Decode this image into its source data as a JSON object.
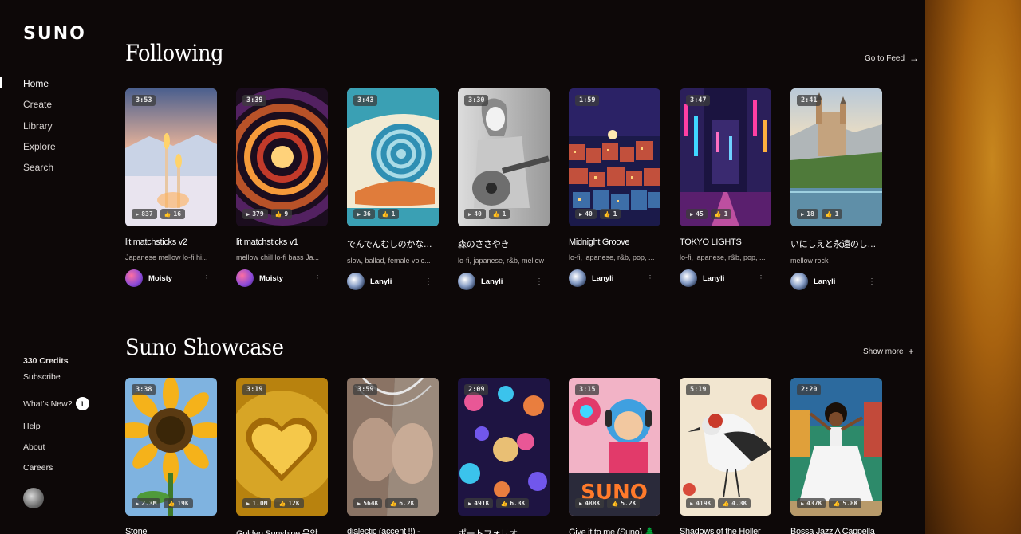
{
  "brand": {
    "logo": "SUNO"
  },
  "nav": [
    {
      "label": "Home",
      "active": true
    },
    {
      "label": "Create"
    },
    {
      "label": "Library"
    },
    {
      "label": "Explore"
    },
    {
      "label": "Search"
    }
  ],
  "account": {
    "credits": "330 Credits",
    "subscribe": "Subscribe",
    "whats_new": "What's New?",
    "whats_new_count": "1",
    "links": [
      "Help",
      "About",
      "Careers"
    ]
  },
  "following": {
    "title": "Following",
    "link": "Go to Feed",
    "cards": [
      {
        "duration": "3:53",
        "plays": "837",
        "likes": "16",
        "title": "lit matchsticks v2",
        "tags": "Japanese mellow lo-fi hi...",
        "user": "Moisty",
        "art": "candles",
        "avatar": "moisty"
      },
      {
        "duration": "3:39",
        "plays": "379",
        "likes": "9",
        "title": "lit matchsticks v1",
        "tags": "mellow chill lo-fi bass Ja...",
        "user": "Moisty",
        "art": "spiral",
        "avatar": "moisty"
      },
      {
        "duration": "3:43",
        "plays": "36",
        "likes": "1",
        "title": "でんでんむしのかなしみ",
        "tags": "slow, ballad, female voic...",
        "user": "Lanyli",
        "art": "snail",
        "avatar": "lanyli"
      },
      {
        "duration": "3:30",
        "plays": "40",
        "likes": "1",
        "title": "森のささやき",
        "tags": "lo-fi, japanese, r&b, mellow",
        "user": "Lanyli",
        "art": "guitar",
        "avatar": "lanyli"
      },
      {
        "duration": "1:59",
        "plays": "40",
        "likes": "1",
        "title": "Midnight Groove",
        "tags": "lo-fi, japanese, r&b, pop, ...",
        "user": "Lanyli",
        "art": "town",
        "avatar": "lanyli"
      },
      {
        "duration": "3:47",
        "plays": "45",
        "likes": "1",
        "title": "TOKYO LIGHTS",
        "tags": "lo-fi, japanese, r&b, pop, ...",
        "user": "Lanyli",
        "art": "neon",
        "avatar": "lanyli"
      },
      {
        "duration": "2:41",
        "plays": "18",
        "likes": "1",
        "title": "いにしえと永遠のしらべ",
        "tags": "mellow rock",
        "user": "Lanyli",
        "art": "castle",
        "avatar": "lanyli"
      }
    ]
  },
  "showcase": {
    "title": "Suno Showcase",
    "link": "Show more",
    "cards": [
      {
        "duration": "3:38",
        "plays": "2.3M",
        "likes": "19K",
        "title": "Stone",
        "art": "sunflower"
      },
      {
        "duration": "3:19",
        "plays": "1.0M",
        "likes": "12K",
        "title": "Golden Sunshine 음악",
        "art": "heart"
      },
      {
        "duration": "3:59",
        "plays": "564K",
        "likes": "6.2K",
        "title": "dialectic (accent !!) -",
        "art": "faces"
      },
      {
        "duration": "2:09",
        "plays": "491K",
        "likes": "6.3K",
        "title": "ポートフォリオ",
        "art": "bokeh"
      },
      {
        "duration": "3:15",
        "plays": "488K",
        "likes": "5.2K",
        "title": "Give it to me (Suno) 🌲",
        "art": "dj"
      },
      {
        "duration": "5:19",
        "plays": "419K",
        "likes": "4.3K",
        "title": "Shadows of the Holler",
        "art": "bird"
      },
      {
        "duration": "2:20",
        "plays": "437K",
        "likes": "5.8K",
        "title": "Bossa Jazz A Cappella",
        "art": "dancer"
      }
    ]
  },
  "colors": {
    "background": "#0d0808",
    "accent_glow": "#c7861e"
  }
}
